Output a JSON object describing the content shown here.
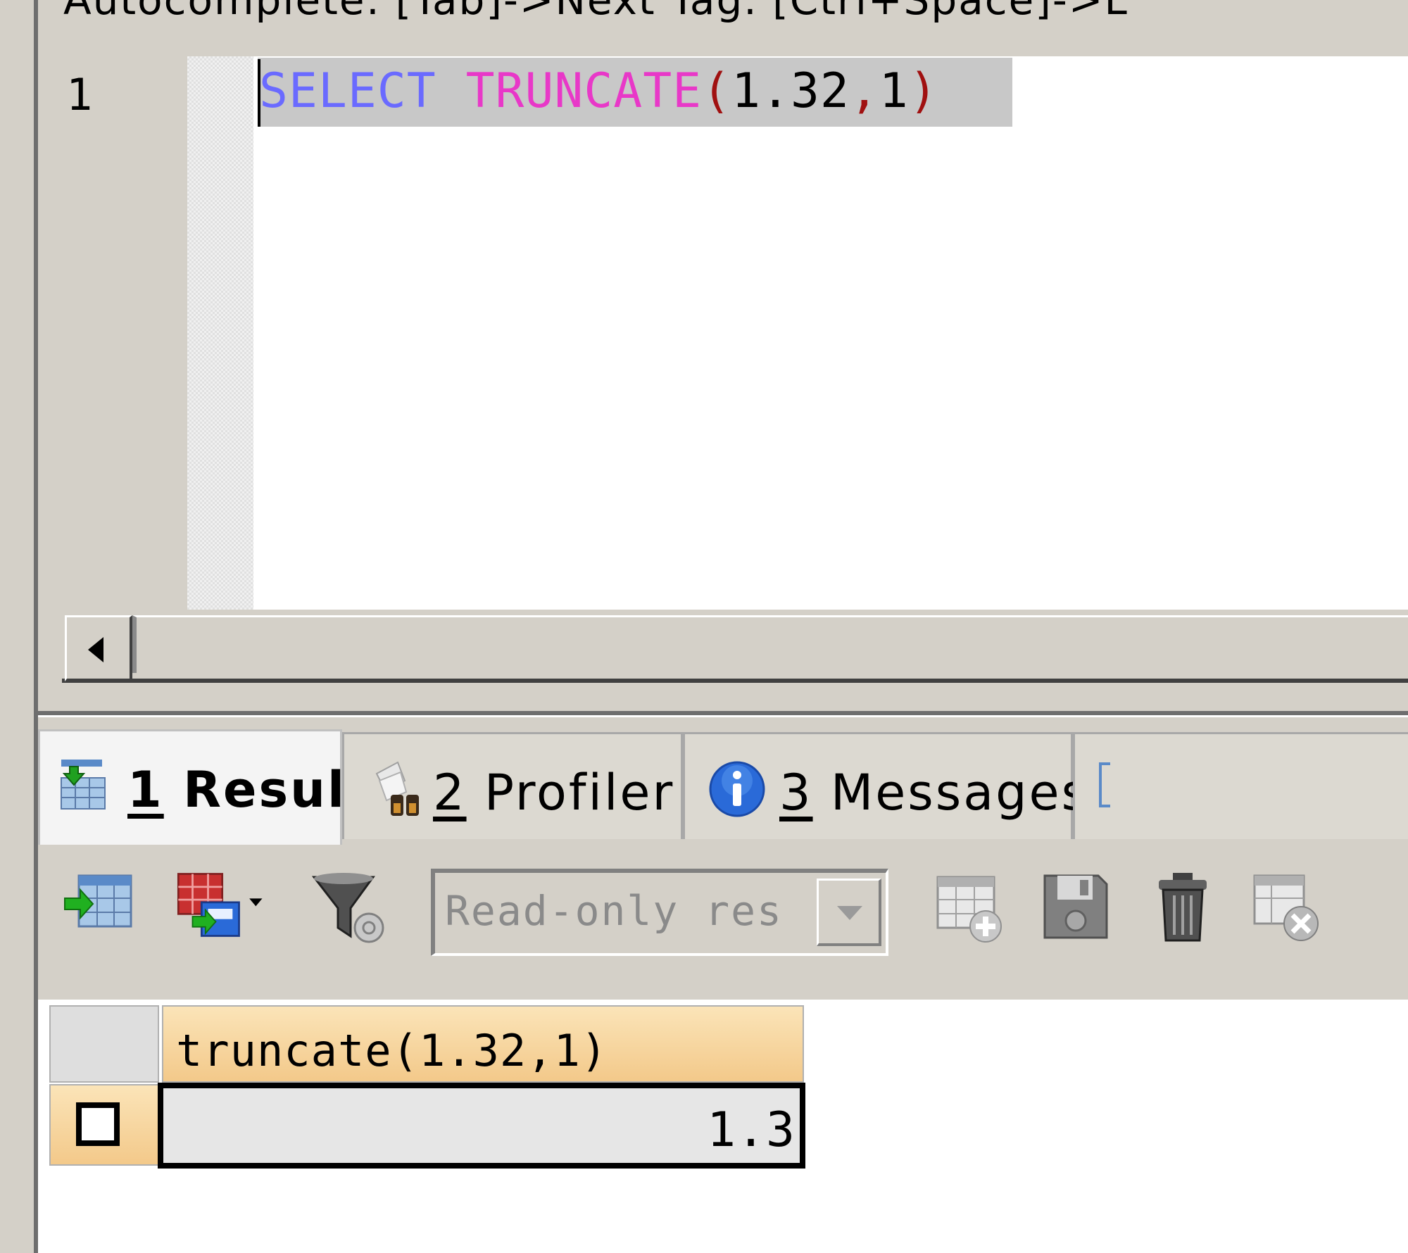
{
  "hint_bar": {
    "text": "Autocomplete: [Tab]->Next Tag. [Ctrl+Space]->L"
  },
  "editor": {
    "line_number": "1",
    "code": {
      "keyword": "SELECT",
      "function": "TRUNCATE",
      "open_paren": "(",
      "arg1": "1.32",
      "comma": ",",
      "arg2": "1",
      "close_paren": ")"
    }
  },
  "tabs": [
    {
      "num": "1",
      "label": "Result",
      "icon": "result-grid-icon",
      "active": true
    },
    {
      "num": "2",
      "label": "Profiler",
      "icon": "profiler-binoculars-icon",
      "active": false
    },
    {
      "num": "3",
      "label": "Messages",
      "icon": "info-icon",
      "active": false
    }
  ],
  "toolbar": {
    "readonly_combo": "Read-only res",
    "icons": [
      "export-data-icon",
      "export-options-icon",
      "filter-icon",
      "add-row-icon",
      "save-icon",
      "delete-icon",
      "cancel-changes-icon"
    ]
  },
  "grid": {
    "column_header": "truncate(1.32,1)",
    "rows": [
      {
        "value": "1.3"
      }
    ]
  }
}
